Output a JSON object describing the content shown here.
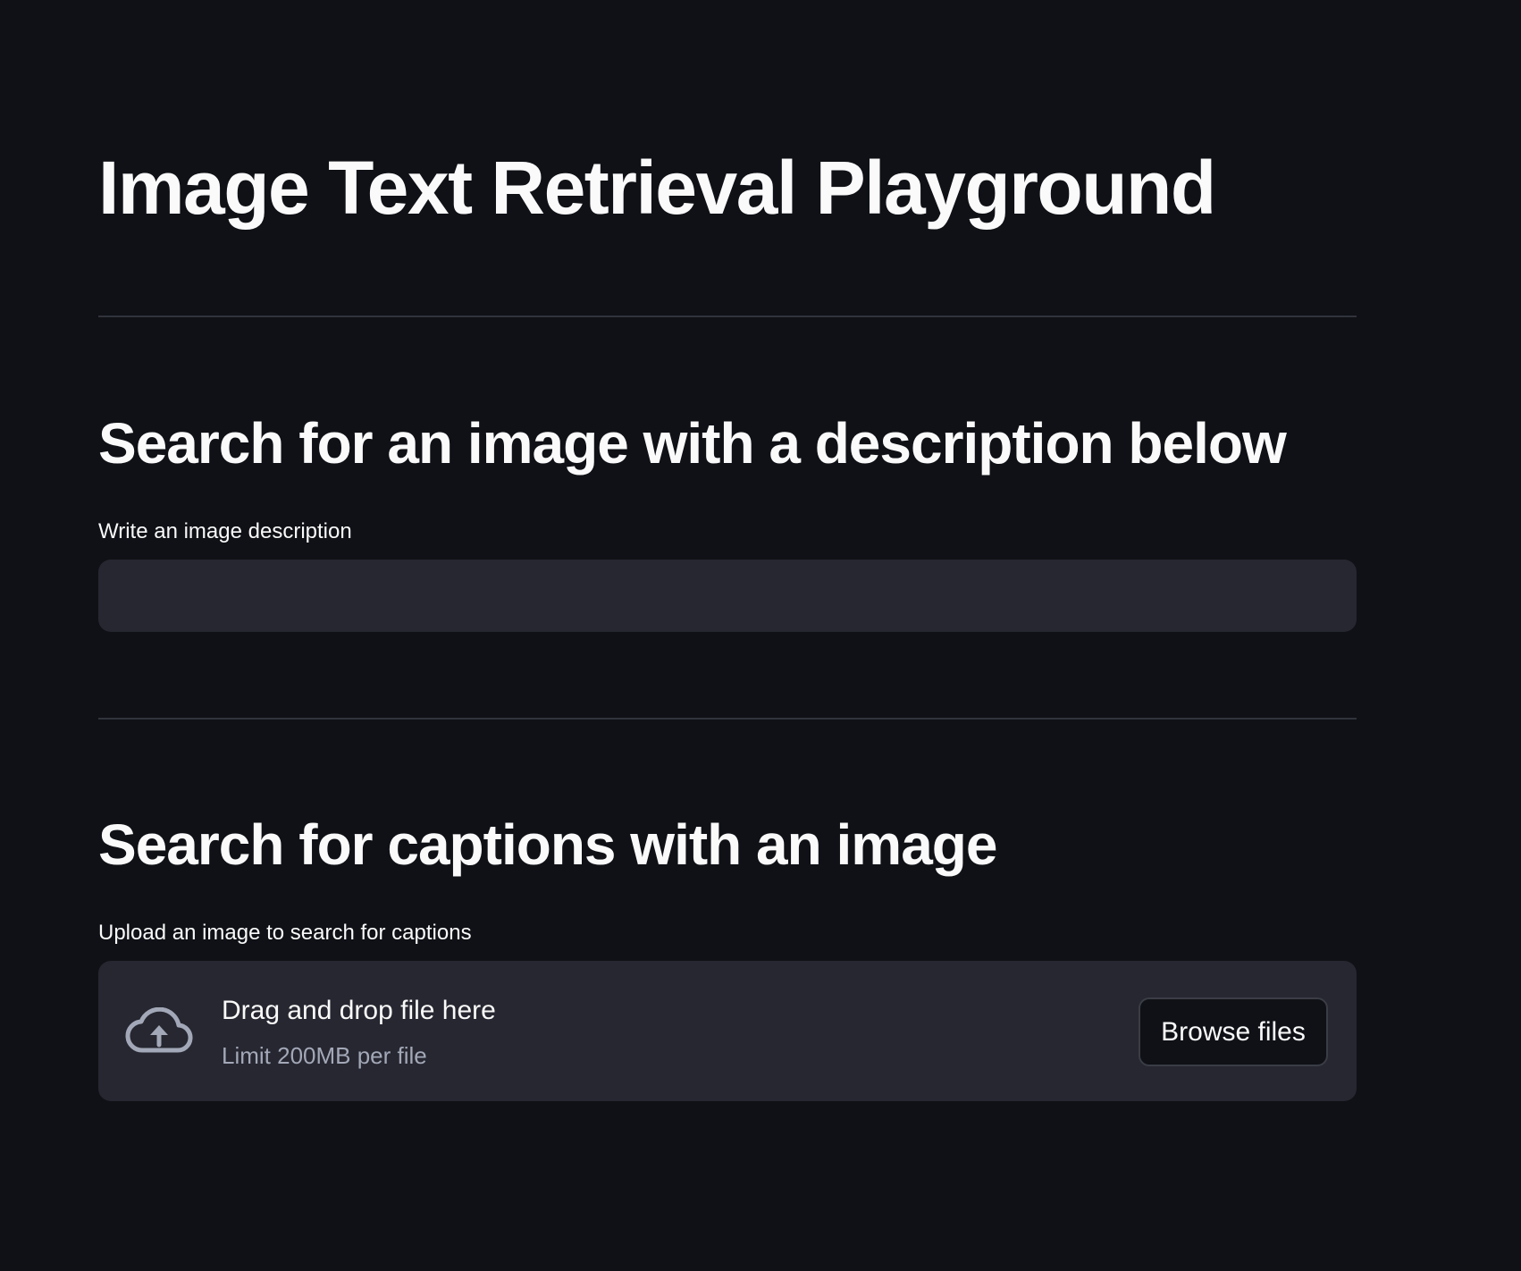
{
  "page": {
    "title": "Image Text Retrieval Playground"
  },
  "text_search": {
    "heading": "Search for an image with a description below",
    "label": "Write an image description",
    "value": "",
    "placeholder": ""
  },
  "image_search": {
    "heading": "Search for captions with an image",
    "label": "Upload an image to search for captions",
    "uploader": {
      "icon": "cloud-upload-icon",
      "drop_title": "Drag and drop file here",
      "limit_text": "Limit 200MB per file",
      "browse_label": "Browse files"
    }
  },
  "colors": {
    "background": "#0f1116",
    "surface": "#262730",
    "divider": "#31333c",
    "text": "#fafafa",
    "muted_text": "#a3a8b8",
    "icon": "#a3a8b8"
  }
}
